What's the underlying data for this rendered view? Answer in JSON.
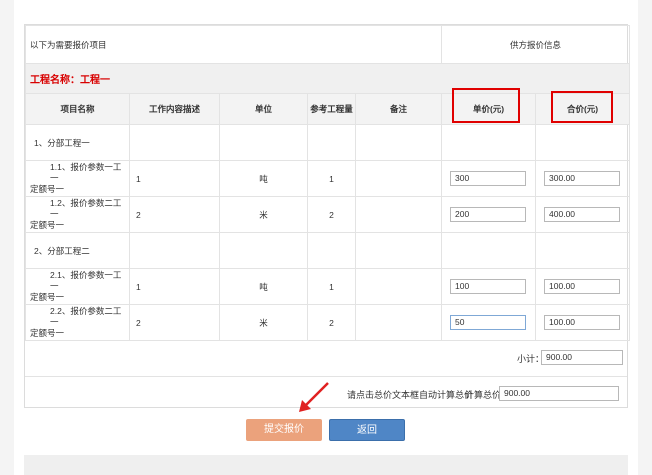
{
  "header": {
    "left_text": "以下为需要报价项目",
    "right_text": "供方报价信息"
  },
  "project": {
    "name_label": "工程名称：工程一"
  },
  "columns": {
    "name": "项目名称",
    "content": "工作内容描述",
    "unit": "单位",
    "ref_qty": "参考工程量",
    "note": "备注",
    "unit_price": "单价(元)",
    "total": "合价(元)"
  },
  "sections": [
    {
      "title": "1、分部工程一",
      "items": [
        {
          "name_line1": "1.1、报价参数一工一",
          "name_line2": "定额号一",
          "content": "1",
          "unit": "吨",
          "ref_qty": "1",
          "unit_price": "300",
          "total": "300.00"
        },
        {
          "name_line1": "1.2、报价参数二工一",
          "name_line2": "定额号一",
          "content": "2",
          "unit": "米",
          "ref_qty": "2",
          "unit_price": "200",
          "total": "400.00"
        }
      ]
    },
    {
      "title": "2、分部工程二",
      "items": [
        {
          "name_line1": "2.1、报价参数一工一",
          "name_line2": "定额号一",
          "content": "1",
          "unit": "吨",
          "ref_qty": "1",
          "unit_price": "100",
          "total": "100.00"
        },
        {
          "name_line1": "2.2、报价参数二工一",
          "name_line2": "定额号一",
          "content": "2",
          "unit": "米",
          "ref_qty": "2",
          "unit_price": "50",
          "total": "100.00"
        }
      ]
    }
  ],
  "subtotal": {
    "label": "小计：",
    "value": "900.00"
  },
  "calc": {
    "hint": "请点击总价文本框自动计算总价",
    "label": "计算总价",
    "value": "900.00"
  },
  "buttons": {
    "submit": "提交报价",
    "back": "返回"
  },
  "colors": {
    "project_red": "#d80000",
    "highlight_red": "#e00000",
    "submit_bg": "#eba27c",
    "back_bg": "#4f86c6",
    "arrow_red": "#e02020"
  }
}
